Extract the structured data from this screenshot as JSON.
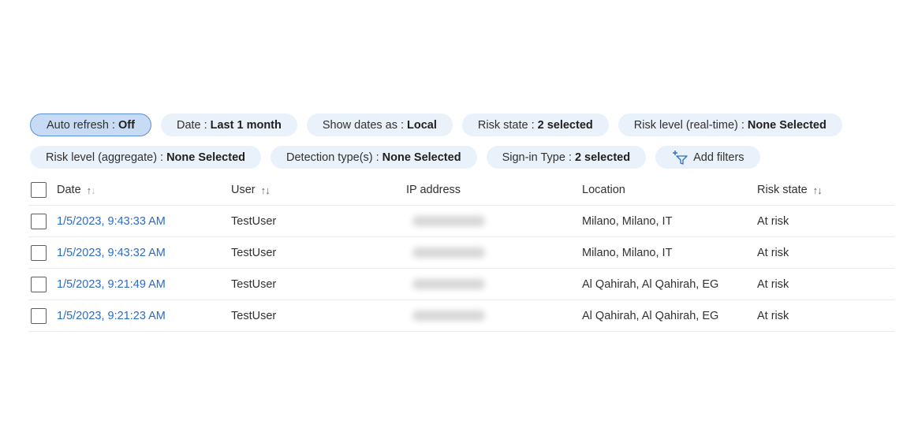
{
  "filters_row1": [
    {
      "label": "Auto refresh",
      "value": "Off",
      "active": true
    },
    {
      "label": "Date",
      "value": "Last 1 month"
    },
    {
      "label": "Show dates as",
      "value": "Local"
    },
    {
      "label": "Risk state",
      "value": "2 selected"
    },
    {
      "label": "Risk level (real-time)",
      "value": "None Selected"
    }
  ],
  "filters_row2": [
    {
      "label": "Risk level (aggregate)",
      "value": "None Selected"
    },
    {
      "label": "Detection type(s)",
      "value": "None Selected"
    },
    {
      "label": "Sign-in Type",
      "value": "2 selected"
    }
  ],
  "separator": ":",
  "add_filters_label": "Add filters",
  "table": {
    "columns": {
      "date": "Date",
      "user": "User",
      "ip": "IP address",
      "location": "Location",
      "risk_state": "Risk state"
    },
    "rows": [
      {
        "date": "1/5/2023, 9:43:33 AM",
        "user": "TestUser",
        "location": "Milano, Milano, IT",
        "risk_state": "At risk"
      },
      {
        "date": "1/5/2023, 9:43:32 AM",
        "user": "TestUser",
        "location": "Milano, Milano, IT",
        "risk_state": "At risk"
      },
      {
        "date": "1/5/2023, 9:21:49 AM",
        "user": "TestUser",
        "location": "Al Qahirah, Al Qahirah, EG",
        "risk_state": "At risk"
      },
      {
        "date": "1/5/2023, 9:21:23 AM",
        "user": "TestUser",
        "location": "Al Qahirah, Al Qahirah, EG",
        "risk_state": "At risk"
      }
    ]
  },
  "icons": {
    "add_filter": "filter-add-icon",
    "sort": "sort-arrows-icon"
  },
  "colors": {
    "pill_bg": "#e9f1fa",
    "pill_active_bg": "#c7dcf4",
    "pill_active_border": "#5b8fd6",
    "link": "#2b6cc4"
  }
}
